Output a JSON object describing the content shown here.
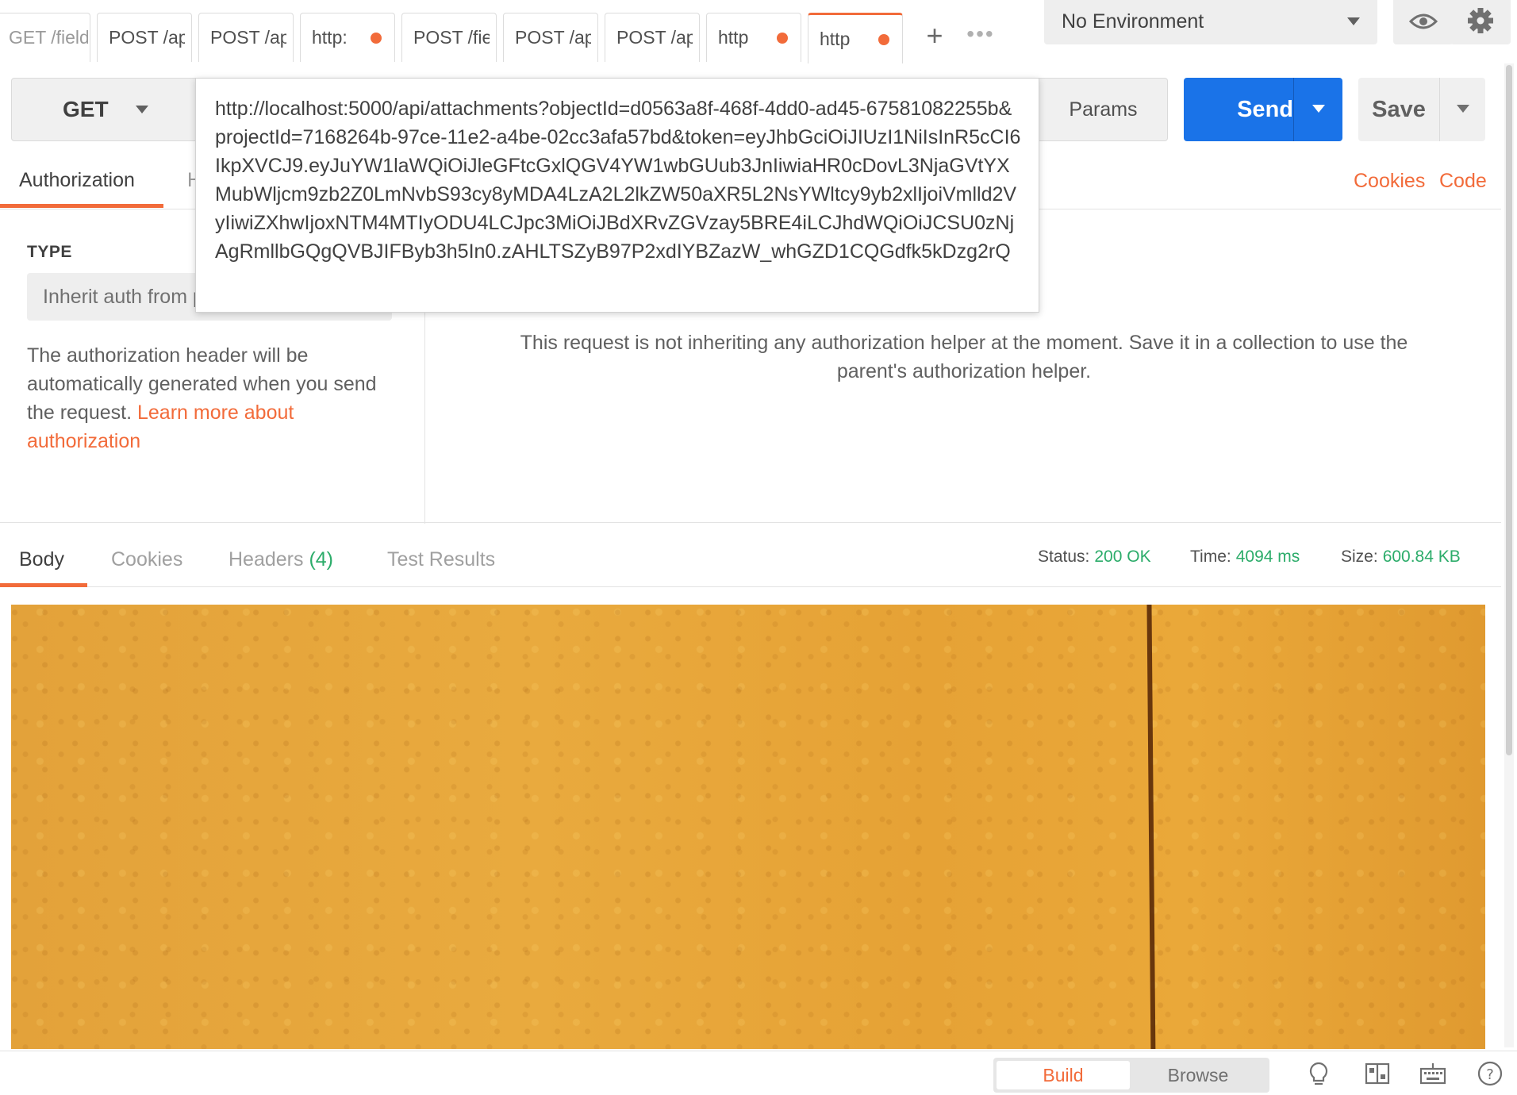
{
  "tabs": [
    {
      "label": "GET /fields",
      "dirty": false
    },
    {
      "label": "POST /api/",
      "dirty": false
    },
    {
      "label": "POST /api/",
      "dirty": false
    },
    {
      "label": "http:",
      "dirty": true
    },
    {
      "label": "POST /fiel",
      "dirty": false
    },
    {
      "label": "POST /api/",
      "dirty": false
    },
    {
      "label": "POST /api/",
      "dirty": false
    },
    {
      "label": "http",
      "dirty": true
    },
    {
      "label": "http",
      "dirty": true
    }
  ],
  "environment": {
    "selected": "No Environment"
  },
  "request": {
    "method": "GET",
    "url": "http://localhost:5000/api/attachments?objectId=d0563a8f-468f-4dd0-ad45-67581082255b&projectId=7168264b-97ce-11e2-a4be-02cc3afa57bd&token=eyJhbGciOiJIUzI1NiIsInR5cCI6IkpXVCJ9.eyJuYW1laWQiOiJleGFtcGxlQGV4YW1wbGUub3JnIiwiaHR0cDovL3NjaGVtYXMubWljcm9zb2Z0LmNvbS93cy8yMDA4LzA2L2lkZW50aXR5L2NsYWltcy9yb2xlIjoiVmlld2VyIiwiZXhwIjoxNTM4MTIyODU4LCJpc3MiOiJBdXRvZGVzay5BRE4iLCJhdWQiOiJCSU0zNjAgRmllbGQgQVBJIFByb3h5In0.zAHLTSZyB97P2xdIYBZazW_whGZD1CQGdfk5kDzg2rQ",
    "params_label": "Params",
    "send_label": "Send",
    "save_label": "Save"
  },
  "request_tabs": {
    "authorization": "Authorization",
    "headers_partial": "H",
    "cookies_link": "Cookies",
    "code_link": "Code"
  },
  "auth": {
    "type_label": "TYPE",
    "type_value": "Inherit auth from parent",
    "help_text": "The authorization header will be automatically generated when you send the request. ",
    "help_link": "Learn more about authorization",
    "message": "This request is not inheriting any authorization helper at the moment. Save it in a collection to use the parent's authorization helper."
  },
  "response": {
    "tabs": {
      "body": "Body",
      "cookies": "Cookies",
      "headers": "Headers",
      "headers_count": "(4)",
      "tests": "Test Results"
    },
    "status_label": "Status:",
    "status_value": "200 OK",
    "time_label": "Time:",
    "time_value": "4094 ms",
    "size_label": "Size:",
    "size_value": "600.84 KB"
  },
  "footer": {
    "build": "Build",
    "browse": "Browse"
  },
  "colors": {
    "accent": "#f26b3a",
    "primary": "#1a73e8",
    "success": "#2cac6a"
  }
}
